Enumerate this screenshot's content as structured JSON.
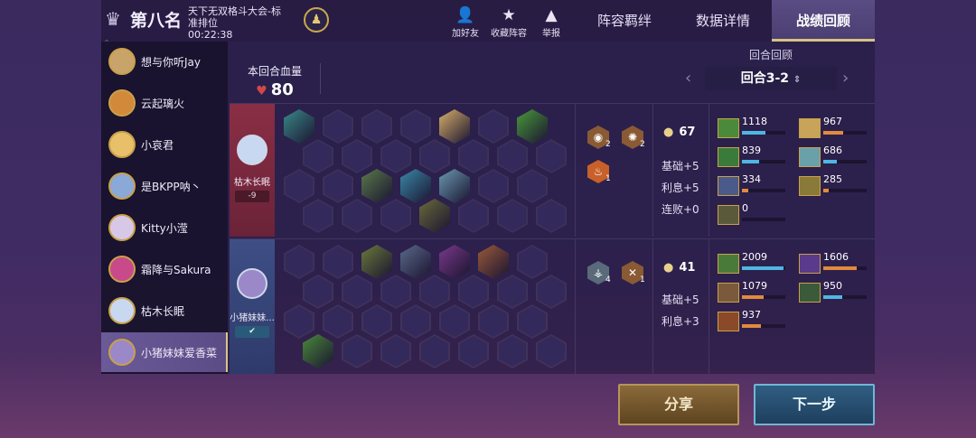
{
  "header": {
    "rank_text": "第八名",
    "mode_line1": "天下无双格斗大会-标",
    "mode_line2": "准排位",
    "timer": "00:22:38",
    "tools": [
      {
        "icon": "add-friend-icon",
        "label": "加好友"
      },
      {
        "icon": "star-icon",
        "label": "收藏阵容"
      },
      {
        "icon": "warning-icon",
        "label": "举报"
      }
    ],
    "tabs": [
      {
        "label": "阵容羁绊",
        "active": false
      },
      {
        "label": "数据详情",
        "active": false
      },
      {
        "label": "战绩回顾",
        "active": true
      }
    ]
  },
  "sidebar": {
    "players": [
      {
        "name": "想与你听Jay",
        "avatar_color": "#c9a46a"
      },
      {
        "name": "云起璃火",
        "avatar_color": "#d28a3a"
      },
      {
        "name": "小哀君",
        "avatar_color": "#e8c06a"
      },
      {
        "name": "是BKPP呐丶",
        "avatar_color": "#8aa8d8"
      },
      {
        "name": "Kitty小滢",
        "avatar_color": "#d8c8e8"
      },
      {
        "name": "霜降与Sakura",
        "avatar_color": "#c84a8a"
      },
      {
        "name": "枯木长眠",
        "avatar_color": "#c8d8f0"
      },
      {
        "name": "小猪妹妹爱香菜",
        "avatar_color": "#9a88c8",
        "active": true
      }
    ]
  },
  "summary": {
    "hp_label": "本回合血量",
    "hp_value": "80",
    "round_title": "回合回顾",
    "round_value": "回合3-2"
  },
  "matchups": [
    {
      "name": "枯木长眠",
      "tag": "-9",
      "side": "red",
      "gold": "67",
      "economy": [
        "基础+5",
        "利息+5",
        "连败+0"
      ],
      "traits": [
        {
          "color": "#8a5a34",
          "count": "2"
        },
        {
          "color": "#8a5a34",
          "count": "2"
        },
        {
          "color": "#c8602a",
          "count": "1"
        }
      ],
      "damage": [
        {
          "value": "1118",
          "pct": 0.55,
          "bar": "b",
          "color": "#4a8a3a"
        },
        {
          "value": "967",
          "pct": 0.45,
          "bar": "o",
          "color": "#c8a45a"
        },
        {
          "value": "839",
          "pct": 0.4,
          "bar": "b",
          "color": "#3a7a3a"
        },
        {
          "value": "686",
          "pct": 0.32,
          "bar": "b",
          "color": "#6aa0a8"
        },
        {
          "value": "334",
          "pct": 0.15,
          "bar": "o",
          "color": "#4a5a8a"
        },
        {
          "value": "285",
          "pct": 0.13,
          "bar": "o",
          "color": "#8a7a3a"
        },
        {
          "value": "0",
          "pct": 0,
          "bar": "o",
          "color": "#5a5a3a"
        }
      ]
    },
    {
      "name": "小猪妹妹...",
      "tag": "✔",
      "side": "blue",
      "gold": "41",
      "economy": [
        "基础+5",
        "利息+3"
      ],
      "traits": [
        {
          "color": "#5a6a7a",
          "count": "4"
        },
        {
          "color": "#8a5a34",
          "count": "1"
        }
      ],
      "damage": [
        {
          "value": "2009",
          "pct": 0.95,
          "bar": "b",
          "color": "#4a7a3a"
        },
        {
          "value": "1606",
          "pct": 0.78,
          "bar": "o",
          "color": "#5a3a8a"
        },
        {
          "value": "1079",
          "pct": 0.5,
          "bar": "o",
          "color": "#7a5a3a"
        },
        {
          "value": "950",
          "pct": 0.44,
          "bar": "b",
          "color": "#3a5a3a"
        },
        {
          "value": "937",
          "pct": 0.44,
          "bar": "o",
          "color": "#8a4a2a"
        }
      ]
    }
  ],
  "buttons": {
    "share": "分享",
    "next": "下一步"
  }
}
